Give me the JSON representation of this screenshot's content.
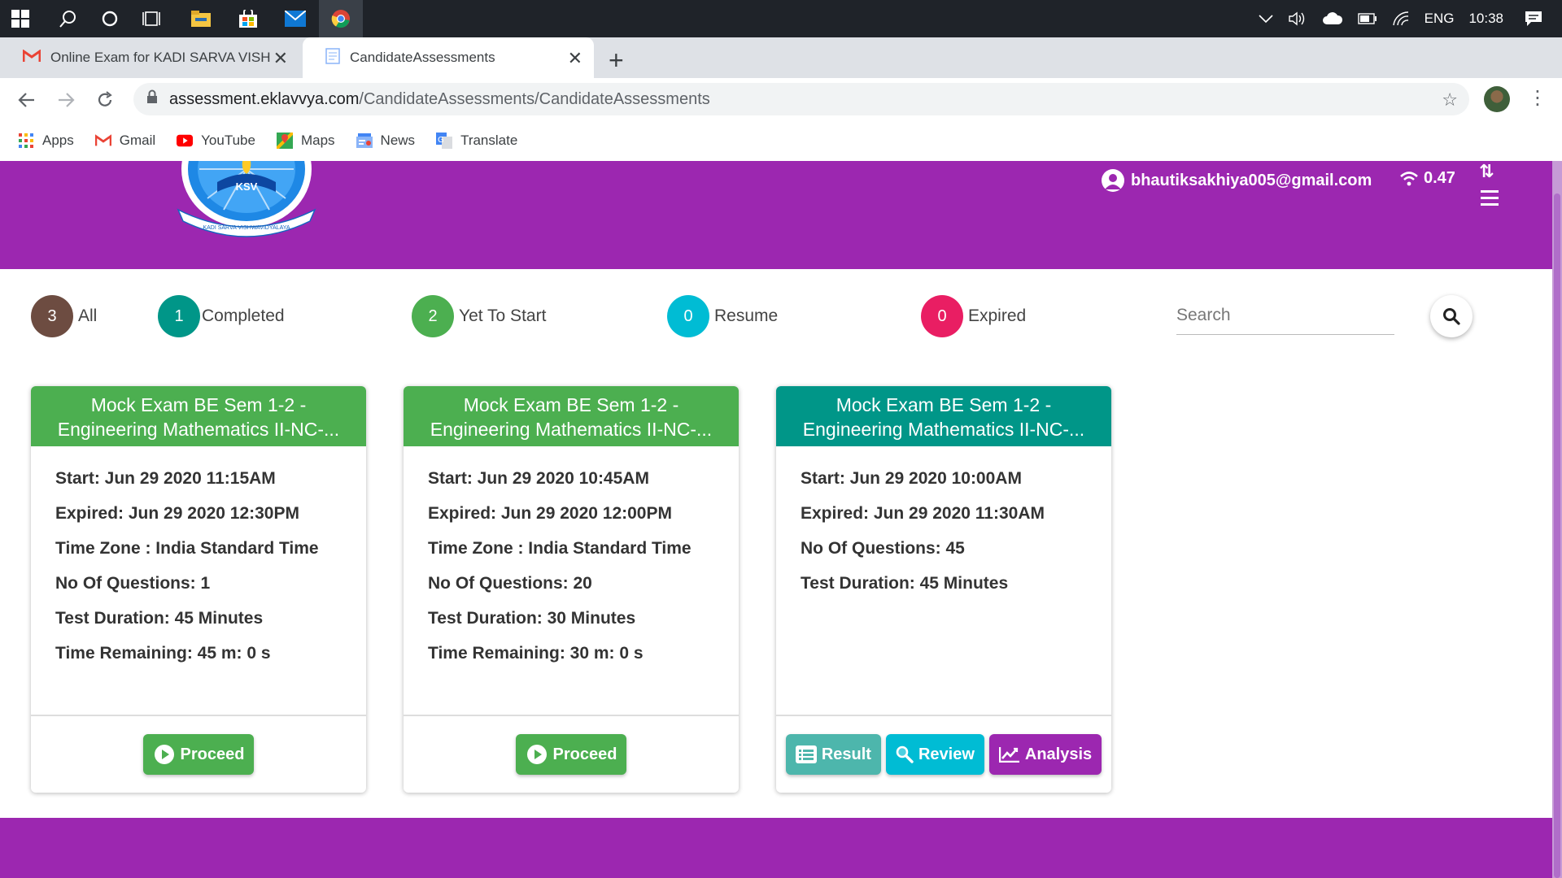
{
  "taskbar": {
    "language": "ENG",
    "clock": "10:38"
  },
  "browser": {
    "tabs": [
      {
        "title": "Online Exam for KADI SARVA VISH"
      },
      {
        "title": "CandidateAssessments"
      }
    ],
    "url_host": "assessment.eklavvya.com",
    "url_path": "/CandidateAssessments/CandidateAssessments",
    "bookmarks": [
      "Apps",
      "Gmail",
      "YouTube",
      "Maps",
      "News",
      "Translate"
    ]
  },
  "header": {
    "email": "bhautiksakhiya005@gmail.com",
    "signal": "0.47",
    "logo_text": "KSV",
    "logo_banner": "KADI SARVA VISHWAVIDYALAYA"
  },
  "filters": [
    {
      "count": "3",
      "label": "All",
      "color": "#6d4c41"
    },
    {
      "count": "1",
      "label": "Completed",
      "color": "#009688"
    },
    {
      "count": "2",
      "label": "Yet To Start",
      "color": "#4caf50"
    },
    {
      "count": "0",
      "label": "Resume",
      "color": "#00bcd4"
    },
    {
      "count": "0",
      "label": "Expired",
      "color": "#e91e63"
    }
  ],
  "search": {
    "placeholder": "Search"
  },
  "cards": [
    {
      "title_line1": "Mock Exam BE Sem 1-2 -",
      "title_line2": "Engineering Mathematics II-NC-...",
      "header_color": "#4caf50",
      "details": [
        "Start: Jun 29 2020 11:15AM",
        "Expired: Jun 29 2020 12:30PM",
        "Time Zone : India Standard Time",
        "No Of Questions: 1",
        "Test Duration: 45 Minutes",
        "Time Remaining: 45 m: 0 s"
      ],
      "button": "Proceed"
    },
    {
      "title_line1": "Mock Exam BE Sem 1-2 -",
      "title_line2": "Engineering Mathematics II-NC-...",
      "header_color": "#4caf50",
      "details": [
        "Start: Jun 29 2020 10:45AM",
        "Expired: Jun 29 2020 12:00PM",
        "Time Zone : India Standard Time",
        "No Of Questions: 20",
        "Test Duration: 30 Minutes",
        "Time Remaining: 30 m: 0 s"
      ],
      "button": "Proceed"
    },
    {
      "title_line1": "Mock Exam BE Sem 1-2 -",
      "title_line2": "Engineering Mathematics II-NC-...",
      "header_color": "#009688",
      "details": [
        "Start: Jun 29 2020 10:00AM",
        "Expired: Jun 29 2020 11:30AM",
        "No Of Questions: 45",
        "Test Duration: 45 Minutes"
      ],
      "buttons": [
        "Result",
        "Review",
        "Analysis"
      ]
    }
  ],
  "colors": {
    "brand_purple": "#9c27b0",
    "proceed_green": "#4caf50",
    "result_teal": "#4db6ac",
    "review_cyan": "#00bcd4",
    "analysis_purple": "#9c27b0"
  }
}
